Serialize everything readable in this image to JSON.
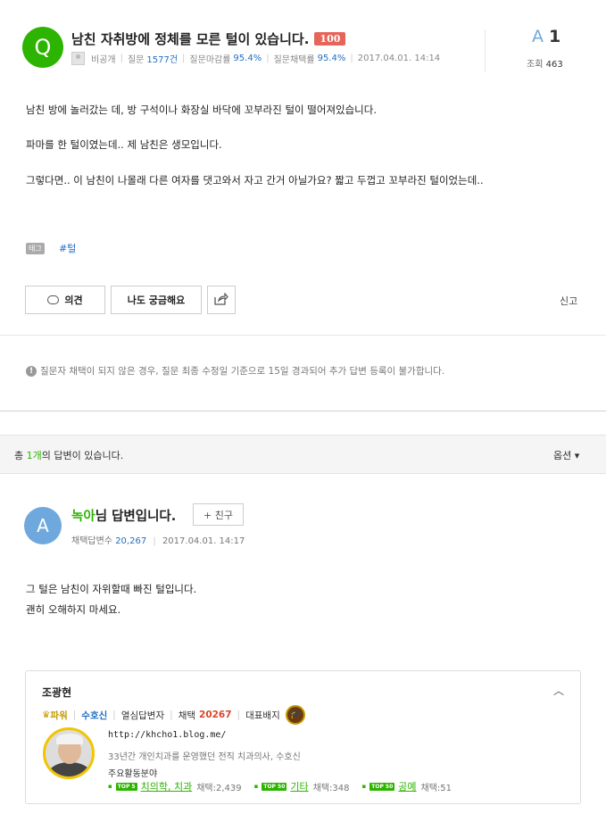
{
  "question": {
    "icon_letter": "Q",
    "title": "남친 자취방에 정체를 모른 털이 있습니다.",
    "badge": "100",
    "author": "비공개",
    "stats": [
      {
        "label": "질문",
        "value": "1577건"
      },
      {
        "label": "질문마감률",
        "value": "95.4%"
      },
      {
        "label": "질문채택률",
        "value": "95.4%"
      }
    ],
    "date": "2017.04.01. 14:14",
    "answer_letter": "A",
    "answer_count": "1",
    "views_label": "조회",
    "views": "463",
    "body": [
      "남친 방에 놀러갔는 데, 방 구석이나 화장실 바닥에 꼬부라진 털이 떨어져있습니다.",
      "파마를 한 털이였는데.. 제 남친은 생모입니다.",
      "그렇다면.. 이 남친이 나몰래 다른 여자를 댓고와서 자고 간거 아닐가요? 짧고 두껍고 꼬부라진 털이었는데.."
    ],
    "tag_label": "태그",
    "tag": "#털"
  },
  "actions": {
    "comment": "의견",
    "curious": "나도 궁금해요",
    "share_icon": "share-icon",
    "report": "신고"
  },
  "notice": "질문자 채택이 되지 않은 경우, 질문 최종 수정일 기준으로 15일 경과되어 추가 답변 등록이 불가합니다.",
  "answers_bar": {
    "prefix": "총",
    "count": "1개",
    "suffix": "의 답변이 있습니다.",
    "options": "옵션 ▾"
  },
  "answer": {
    "icon_letter": "A",
    "author": "녹아",
    "title_suffix": "님 답변입니다.",
    "friend_btn": "+ 친구",
    "adopted_label": "채택답변수",
    "adopted_count": "20,267",
    "date": "2017.04.01. 14:17",
    "body": [
      "그 털은 남친이 자위할때 빠진 털입니다.",
      "괜히 오해하지 마세요."
    ]
  },
  "expert": {
    "name": "조광현",
    "power": "파워",
    "rank": "수호신",
    "role": "열심답변자",
    "adopt_label": "채택",
    "adopt_count": "20267",
    "badge_label": "대표배지",
    "blog": "http://khcho1.blog.me/",
    "intro": "33년간 개인치과를 운영했던 전직 치과의사, 수호신",
    "field_label": "주요활동분야",
    "fields": [
      {
        "top": "TOP 5",
        "name": "치의학, 치과",
        "count": "채택:2,439"
      },
      {
        "top": "TOP 50",
        "name": "기타",
        "count": "채택:348"
      },
      {
        "top": "TOP 50",
        "name": "공예",
        "count": "채택:51"
      }
    ]
  },
  "colors": {
    "green": "#2db400",
    "blue": "#1f6fc1",
    "badge_red": "#e6655a",
    "answer_blue": "#6fa8dc"
  }
}
